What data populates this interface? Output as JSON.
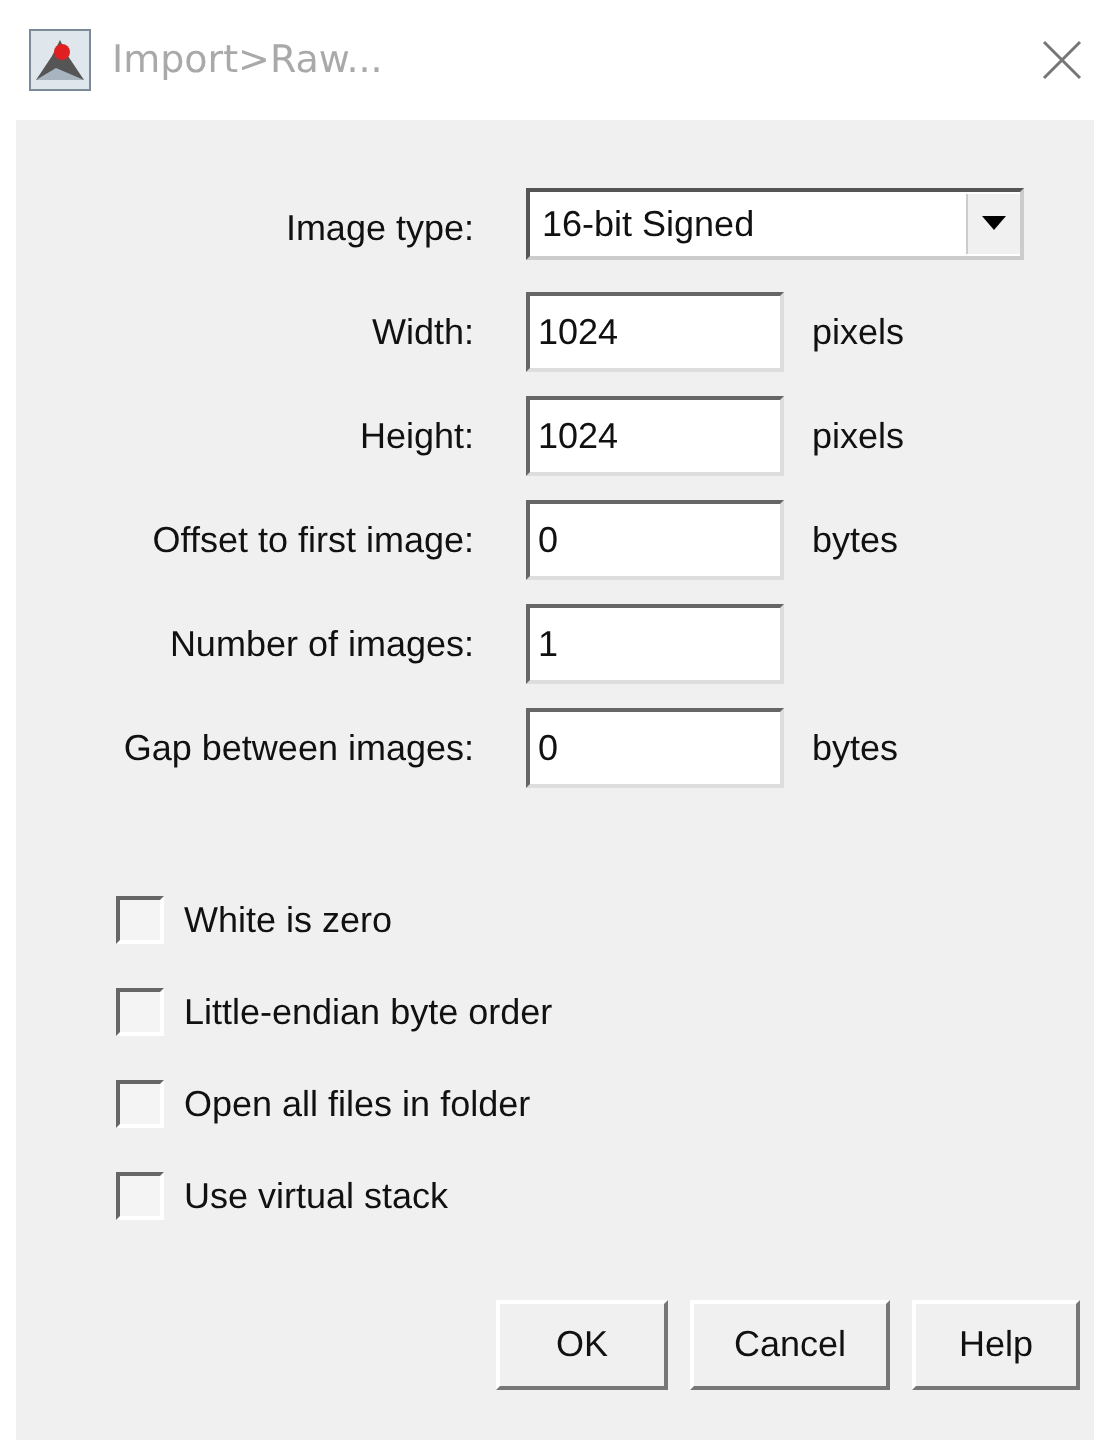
{
  "window": {
    "title": "Import>Raw..."
  },
  "image_type": {
    "label": "Image type:",
    "value": "16-bit Signed"
  },
  "fields": [
    {
      "label": "Width:",
      "value": "1024",
      "unit": "pixels"
    },
    {
      "label": "Height:",
      "value": "1024",
      "unit": "pixels"
    },
    {
      "label": "Offset to first image:",
      "value": "0",
      "unit": "bytes"
    },
    {
      "label": "Number of images:",
      "value": "1"
    },
    {
      "label": "Gap between images:",
      "value": "0",
      "unit": "bytes"
    }
  ],
  "options": [
    {
      "label": "White is zero",
      "checked": false
    },
    {
      "label": "Little-endian byte order",
      "checked": false
    },
    {
      "label": "Open all files in folder",
      "checked": false
    },
    {
      "label": "Use virtual stack",
      "checked": false
    }
  ],
  "buttons": [
    "OK",
    "Cancel",
    "Help"
  ]
}
